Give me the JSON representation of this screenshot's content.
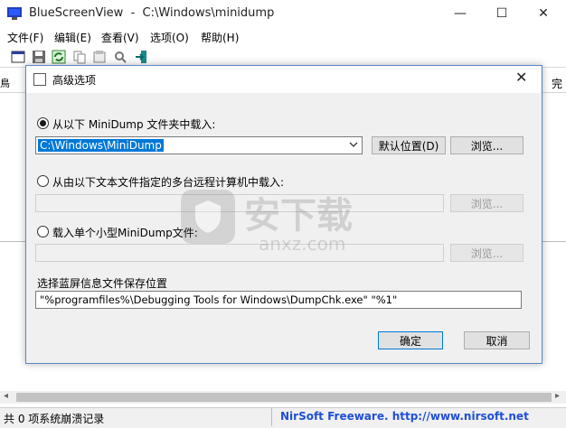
{
  "window": {
    "title": "BlueScreenView",
    "path": "C:\\Windows\\minidump",
    "minimize": "—",
    "maximize": "☐",
    "close": "✕"
  },
  "menu": [
    "文件(F)",
    "编辑(E)",
    "查看(V)",
    "选项(O)",
    "帮助(H)"
  ],
  "list_header_fragment_left": "鳥",
  "list_header_fragment_right": "完",
  "dialog": {
    "title": "高级选项",
    "close": "✕",
    "option1": {
      "label": "从以下 MiniDump 文件夹中载入:",
      "value": "C:\\Windows\\MiniDump",
      "default_button": "默认位置(D)",
      "browse_button": "浏览..."
    },
    "option2": {
      "label": "从由以下文本文件指定的多台远程计算机中载入:",
      "browse_button": "浏览..."
    },
    "option3": {
      "label": "载入单个小型MiniDump文件:",
      "browse_button": "浏览..."
    },
    "save_location_label": "选择蓝屏信息文件保存位置",
    "save_location_value": "\"%programfiles%\\Debugging Tools for Windows\\DumpChk.exe\" \"%1\"",
    "ok_button": "确定",
    "cancel_button": "取消"
  },
  "status": {
    "count": "共 0 项系统崩溃记录",
    "credit": "NirSoft Freeware.  http://www.nirsoft.net"
  },
  "watermark": {
    "text": "安下载",
    "sub": "anxz.com"
  },
  "colors": {
    "accent": "#0078d7",
    "credit": "#1f4fd6"
  }
}
